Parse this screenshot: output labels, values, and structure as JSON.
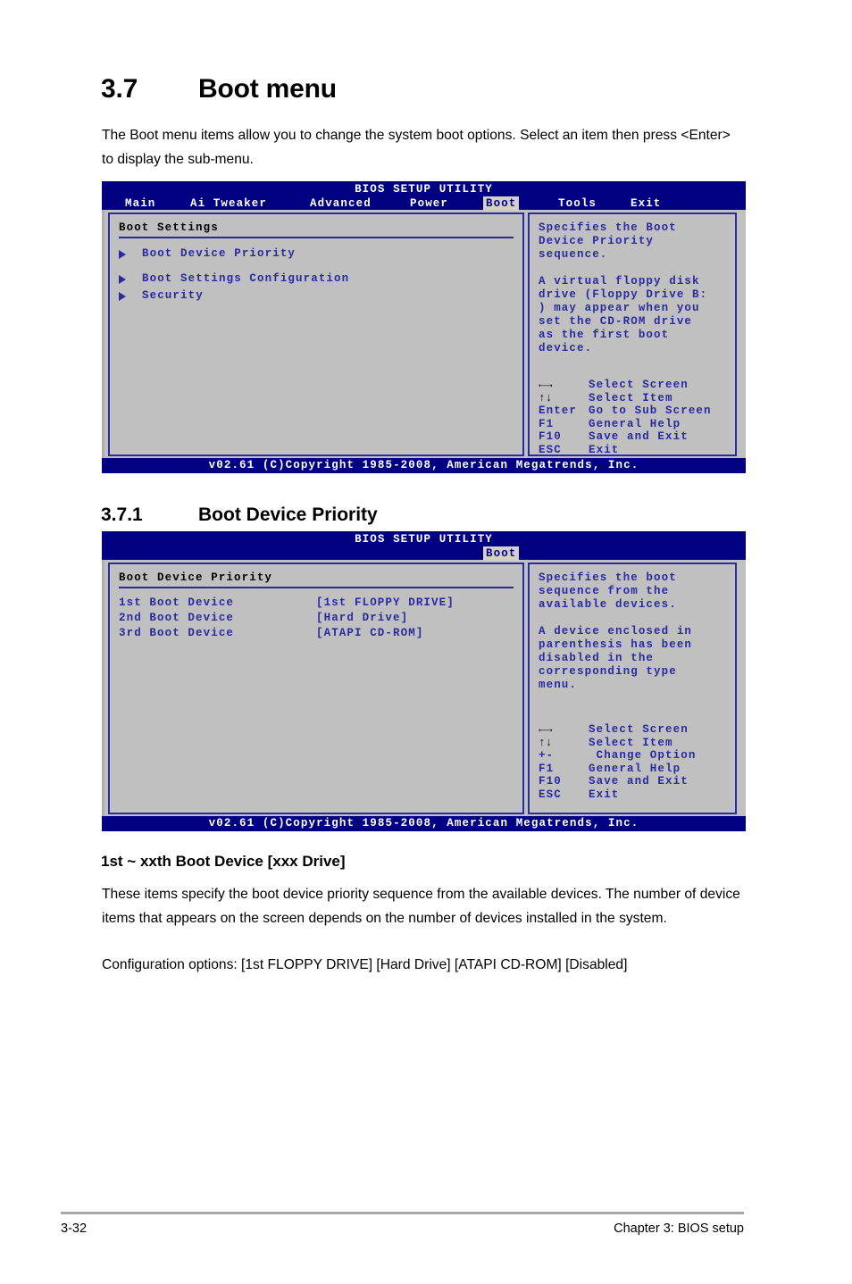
{
  "section_main": {
    "number": "3.7",
    "title": "Boot menu",
    "intro": "The Boot menu items allow you to change the system boot options. Select an item then press <Enter> to display the sub-menu."
  },
  "bios_screen_1": {
    "title": "BIOS SETUP UTILITY",
    "menubar": [
      {
        "label": "Main",
        "active": false
      },
      {
        "label": "Ai Tweaker",
        "active": false
      },
      {
        "label": "Advanced",
        "active": false
      },
      {
        "label": "Power",
        "active": false
      },
      {
        "label": "Boot",
        "active": true
      },
      {
        "label": "Tools",
        "active": false
      },
      {
        "label": "Exit",
        "active": false
      }
    ],
    "panel_title": "Boot Settings",
    "items": [
      {
        "label": "Boot Device Priority"
      },
      {
        "label": "Boot Settings Configuration"
      },
      {
        "label": "Security"
      }
    ],
    "help_paragraphs": [
      "Specifies the Boot\nDevice Priority\nsequence.",
      "A virtual floppy disk\ndrive (Floppy Drive B:\n) may appear when you\nset the CD-ROM drive\nas the first boot\ndevice."
    ],
    "legend": [
      {
        "key": "←→",
        "sym": true,
        "desc": "Select Screen"
      },
      {
        "key": "↑↓",
        "sym": true,
        "desc": "Select Item"
      },
      {
        "key": "Enter",
        "sym": false,
        "desc": "Go to Sub Screen"
      },
      {
        "key": "F1",
        "sym": false,
        "desc": "General Help"
      },
      {
        "key": "F10",
        "sym": false,
        "desc": "Save and Exit"
      },
      {
        "key": "ESC",
        "sym": false,
        "desc": "Exit"
      }
    ],
    "footer": "v02.61 (C)Copyright 1985-2008, American Megatrends, Inc."
  },
  "section_sub": {
    "number": "3.7.1",
    "title": "Boot Device Priority"
  },
  "bios_screen_2": {
    "title": "BIOS SETUP UTILITY",
    "menubar": [
      {
        "label": "Boot",
        "active": true
      }
    ],
    "panel_title": "Boot Device Priority",
    "options": [
      {
        "label": "1st Boot Device",
        "value": "[1st FLOPPY DRIVE]"
      },
      {
        "label": "2nd Boot Device",
        "value": "[Hard Drive]"
      },
      {
        "label": "3rd Boot Device",
        "value": "[ATAPI CD-ROM]"
      }
    ],
    "help_paragraphs": [
      "Specifies the boot\nsequence from the\navailable devices.",
      "A device enclosed in\nparenthesis has been\ndisabled in the\ncorresponding type\nmenu."
    ],
    "legend": [
      {
        "key": "←→",
        "sym": true,
        "desc": "Select Screen"
      },
      {
        "key": "↑↓",
        "sym": true,
        "desc": "Select Item"
      },
      {
        "key": "+-",
        "sym": false,
        "desc": " Change Option"
      },
      {
        "key": "F1",
        "sym": false,
        "desc": "General Help"
      },
      {
        "key": "F10",
        "sym": false,
        "desc": "Save and Exit"
      },
      {
        "key": "ESC",
        "sym": false,
        "desc": "Exit"
      }
    ],
    "footer": "v02.61 (C)Copyright 1985-2008, American Megatrends, Inc."
  },
  "item_doc": {
    "heading": "1st ~ xxth Boot Device [xxx Drive]",
    "paragraph": "These items specify the boot device priority sequence from the available devices. The number of device items that appears on the screen depends on the number of devices installed in the system.",
    "config_options": "Configuration options: [1st FLOPPY DRIVE] [Hard Drive] [ATAPI CD-ROM] [Disabled]"
  },
  "page_footer": {
    "page_number": "3-32",
    "chapter": "Chapter 3: BIOS setup"
  },
  "colors": {
    "bios_navy": "#000080",
    "bios_accent": "#2a2aa0",
    "bios_panel": "#c0c0c0",
    "tab_highlight": "#d4d0c8"
  }
}
